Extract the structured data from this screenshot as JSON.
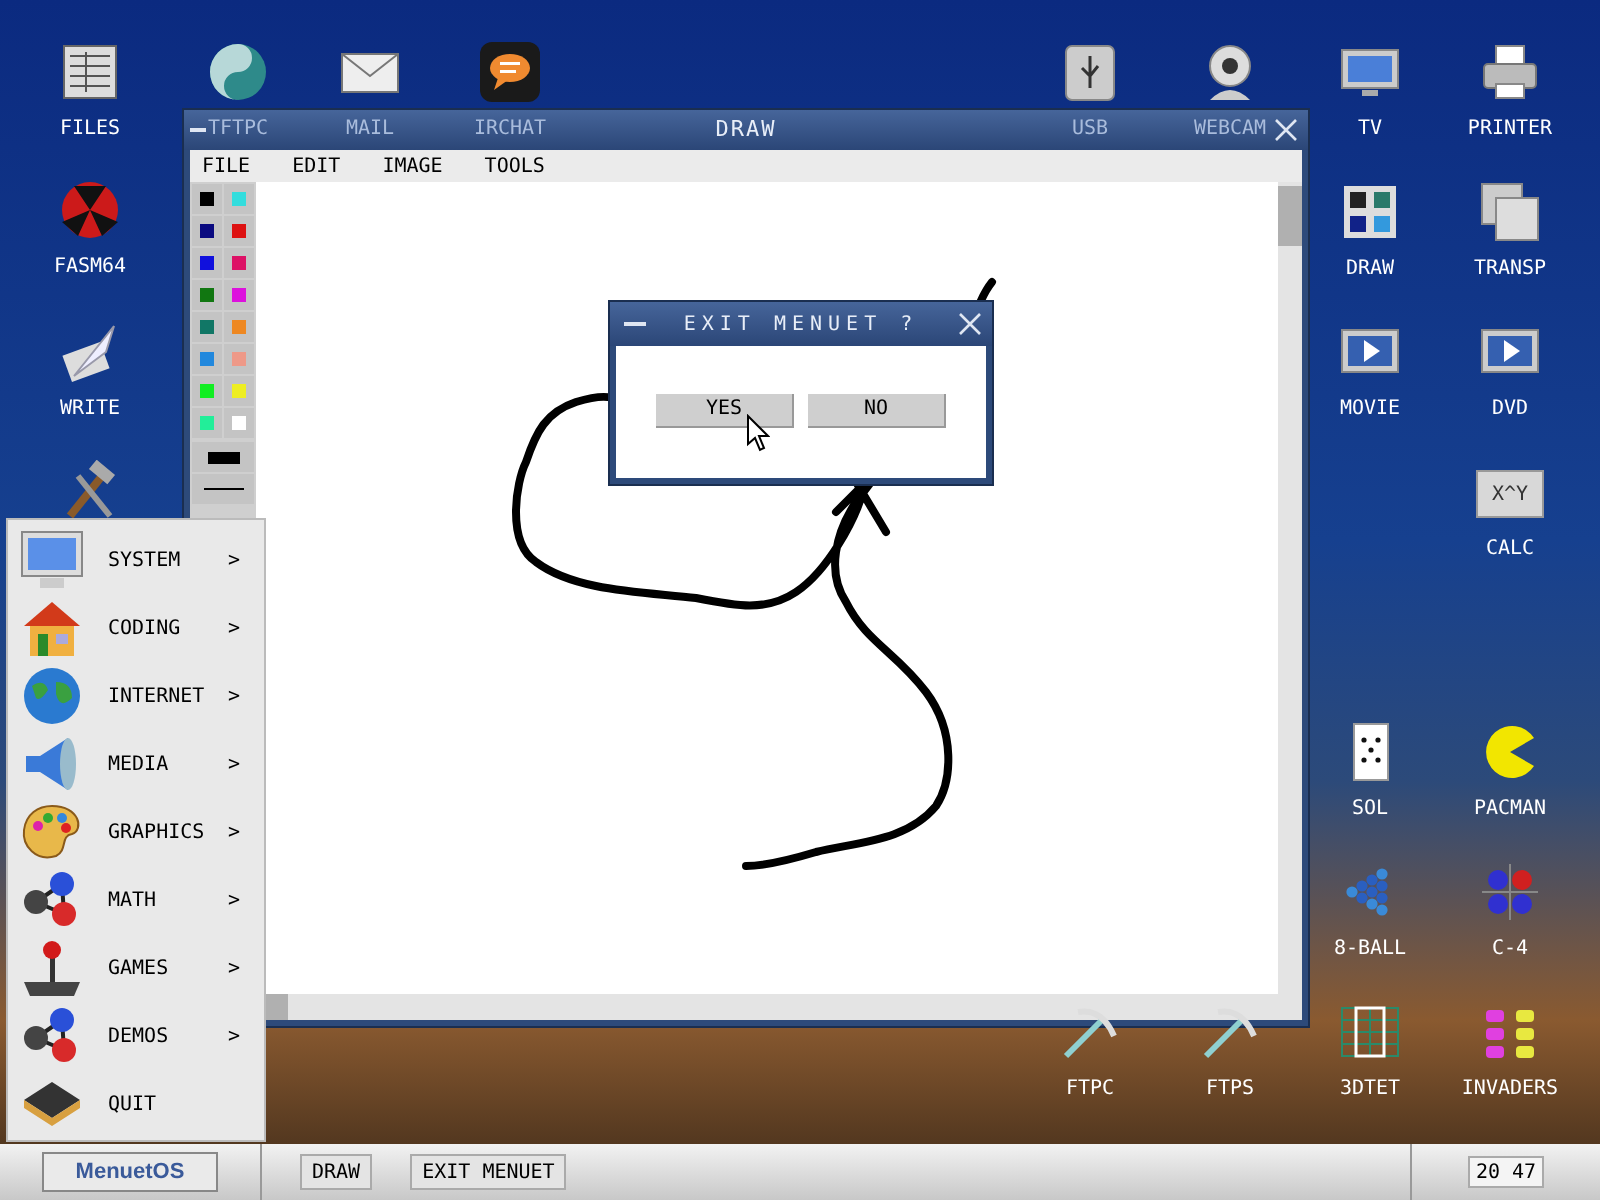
{
  "desktop_icons": [
    {
      "kind": "files",
      "label": "FILES"
    },
    {
      "kind": "swirl",
      "label": "TFTPC",
      "dimmed": true
    },
    {
      "kind": "mail",
      "label": "MAIL",
      "dimmed": true
    },
    {
      "kind": "chat",
      "label": "IRCHAT",
      "dimmed": true
    },
    {
      "kind": "usb",
      "label": "USB",
      "dimmed": true
    },
    {
      "kind": "webcam",
      "label": "WEBCAM",
      "dimmed": true
    },
    {
      "kind": "tv",
      "label": "TV"
    },
    {
      "kind": "printer",
      "label": "PRINTER"
    },
    {
      "kind": "orb",
      "label": "FASM64"
    },
    {
      "kind": "colors",
      "label": "DRAW"
    },
    {
      "kind": "squares",
      "label": "TRANSP"
    },
    {
      "kind": "quill",
      "label": "WRITE"
    },
    {
      "kind": "play",
      "label": "MOVIE"
    },
    {
      "kind": "play",
      "label": "DVD"
    },
    {
      "kind": "tools"
    },
    {
      "kind": "calc",
      "label": "CALC",
      "key": "X^Y"
    },
    {
      "kind": "card",
      "label": "SOL"
    },
    {
      "kind": "pacman",
      "label": "PACMAN"
    },
    {
      "kind": "balls",
      "label": "8-BALL"
    },
    {
      "kind": "four",
      "label": "C-4"
    },
    {
      "kind": "pick",
      "label": "FTPC"
    },
    {
      "kind": "pick",
      "label": "FTPS"
    },
    {
      "kind": "tetris",
      "label": "3DTET"
    },
    {
      "kind": "aliens",
      "label": "INVADERS"
    }
  ],
  "draw_window": {
    "title": "DRAW",
    "menu": [
      "FILE",
      "EDIT",
      "IMAGE",
      "TOOLS"
    ],
    "palette": [
      {
        "color": "#000000"
      },
      {
        "color": "#33dddd"
      },
      {
        "color": "#0a0a80"
      },
      {
        "color": "#dd1111"
      },
      {
        "color": "#1010dd"
      },
      {
        "color": "#dd1166"
      },
      {
        "color": "#117711"
      },
      {
        "color": "#dd11dd"
      },
      {
        "color": "#117766"
      },
      {
        "color": "#ee8822"
      },
      {
        "color": "#2288dd"
      },
      {
        "color": "#ee9988"
      },
      {
        "color": "#11ee22"
      },
      {
        "color": "#eeee22"
      },
      {
        "color": "#22ee99"
      },
      {
        "color": "#ffffff"
      }
    ]
  },
  "dialog": {
    "title": "EXIT MENUET ?",
    "buttons": [
      "YES",
      "NO"
    ]
  },
  "start_menu": [
    {
      "kind": "system",
      "label": "SYSTEM",
      "arrow": ">"
    },
    {
      "kind": "coding",
      "label": "CODING",
      "arrow": ">"
    },
    {
      "kind": "internet",
      "label": "INTERNET",
      "arrow": ">"
    },
    {
      "kind": "media",
      "label": "MEDIA",
      "arrow": ">"
    },
    {
      "kind": "graphics",
      "label": "GRAPHICS",
      "arrow": ">"
    },
    {
      "kind": "math",
      "label": "MATH",
      "arrow": ">"
    },
    {
      "kind": "games",
      "label": "GAMES",
      "arrow": ">"
    },
    {
      "kind": "demos",
      "label": "DEMOS",
      "arrow": ">"
    },
    {
      "kind": "quit",
      "label": "QUIT"
    }
  ],
  "taskbar": {
    "start": "MenuetOS",
    "tasks": [
      "DRAW",
      "EXIT MENUET"
    ],
    "clock": "20 47"
  }
}
